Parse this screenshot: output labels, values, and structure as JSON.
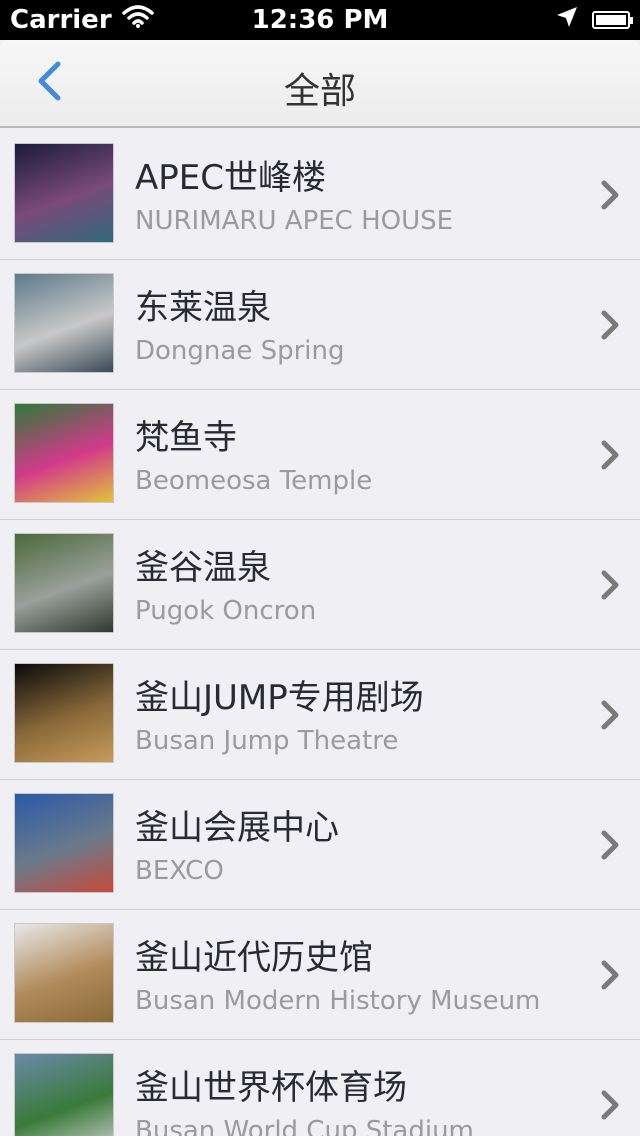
{
  "status_bar": {
    "carrier": "Carrier",
    "time": "12:36 PM"
  },
  "nav": {
    "title": "全部",
    "back_icon": "chevron-left-icon"
  },
  "items": [
    {
      "title": "APEC世峰楼",
      "subtitle": "NURIMARU APEC HOUSE",
      "thumb_colors": [
        "#1b1b3a",
        "#7a4a7a",
        "#2f6a7a"
      ]
    },
    {
      "title": "东莱温泉",
      "subtitle": "Dongnae Spring",
      "thumb_colors": [
        "#5d7a8a",
        "#c8c8c8",
        "#3a4a55"
      ]
    },
    {
      "title": "梵鱼寺",
      "subtitle": "Beomeosa Temple",
      "thumb_colors": [
        "#2e7a3a",
        "#d23a8a",
        "#e2c23a"
      ]
    },
    {
      "title": "釜谷温泉",
      "subtitle": "Pugok Oncron",
      "thumb_colors": [
        "#4a6a3a",
        "#9aa09a",
        "#2e3a30"
      ]
    },
    {
      "title": "釜山JUMP专用剧场",
      "subtitle": "Busan Jump Theatre",
      "thumb_colors": [
        "#0a0a0a",
        "#8a6a3a",
        "#c89a5a"
      ]
    },
    {
      "title": "釜山会展中心",
      "subtitle": "BEXCO",
      "thumb_colors": [
        "#2a5aa8",
        "#6a7a8a",
        "#c84a3a"
      ]
    },
    {
      "title": "釜山近代历史馆",
      "subtitle": "Busan Modern History Museum",
      "thumb_colors": [
        "#e8e8e8",
        "#b08a5a",
        "#8a6a3a"
      ]
    },
    {
      "title": "釜山世界杯体育场",
      "subtitle": "Busan World Cup Stadium",
      "thumb_colors": [
        "#6a8aa8",
        "#3a7a3a",
        "#d0d0d0"
      ]
    }
  ]
}
